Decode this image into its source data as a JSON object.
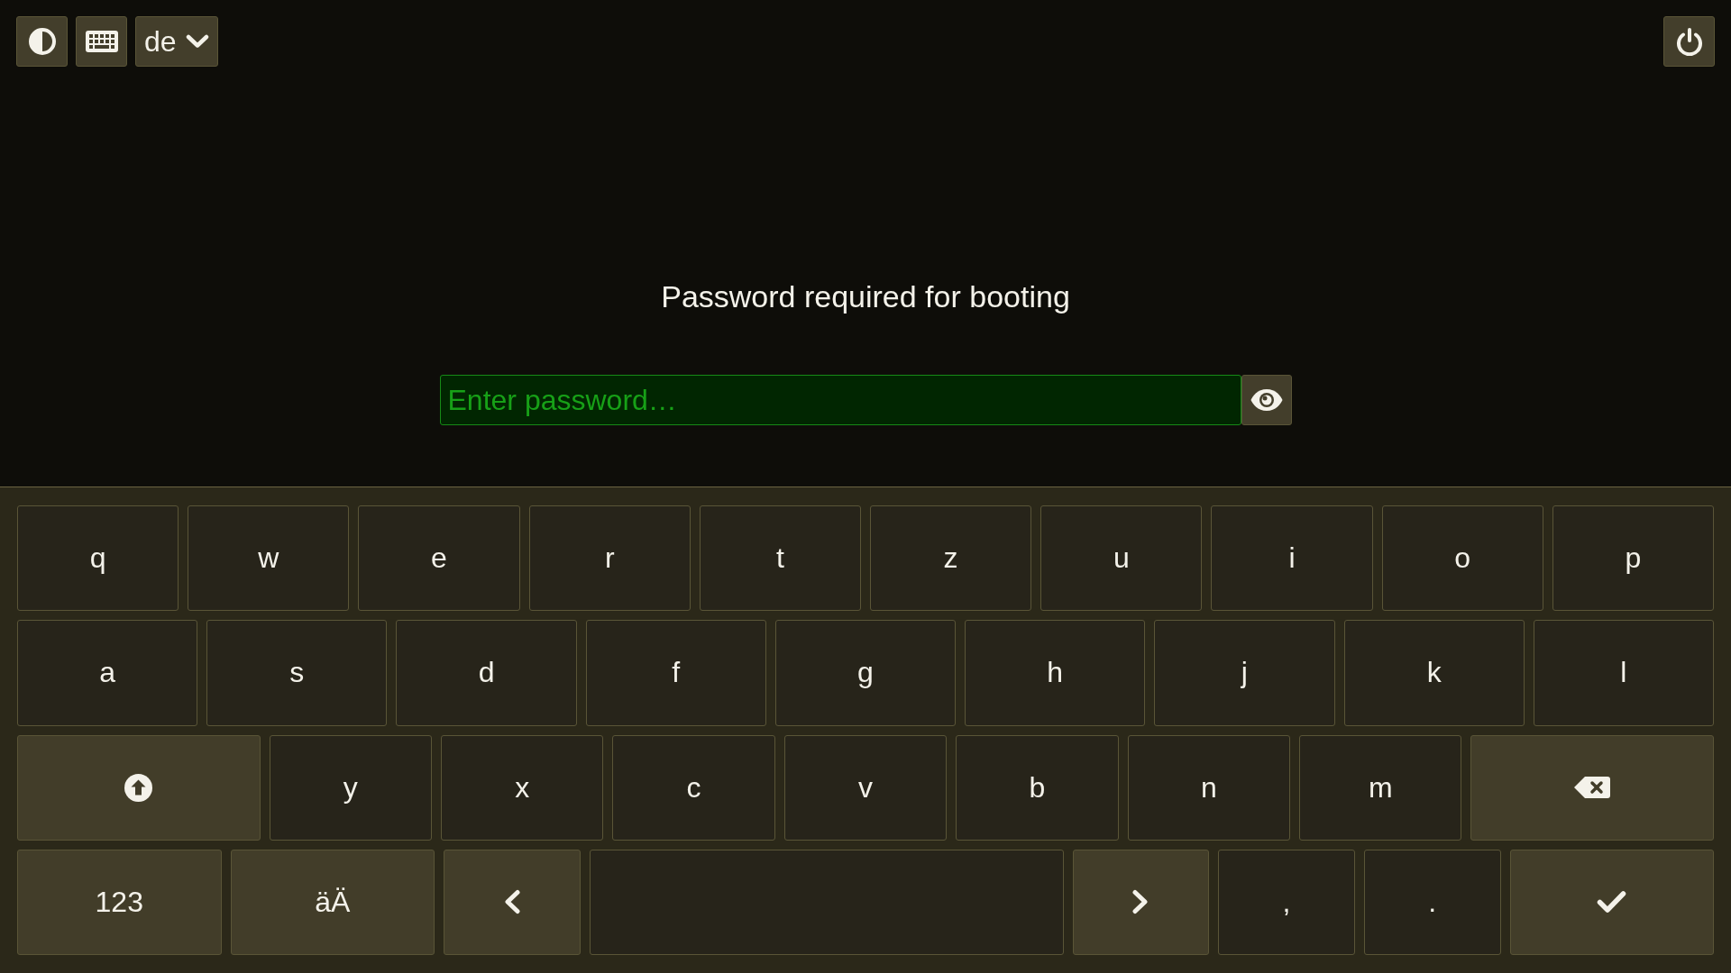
{
  "top_bar": {
    "language": "de"
  },
  "prompt": "Password required for booting",
  "password_field": {
    "placeholder": "Enter password…"
  },
  "keyboard": {
    "rows": [
      {
        "keys": [
          {
            "kind": "char",
            "label": "q"
          },
          {
            "kind": "char",
            "label": "w"
          },
          {
            "kind": "char",
            "label": "e"
          },
          {
            "kind": "char",
            "label": "r"
          },
          {
            "kind": "char",
            "label": "t"
          },
          {
            "kind": "char",
            "label": "z"
          },
          {
            "kind": "char",
            "label": "u"
          },
          {
            "kind": "char",
            "label": "i"
          },
          {
            "kind": "char",
            "label": "o"
          },
          {
            "kind": "char",
            "label": "p"
          }
        ]
      },
      {
        "keys": [
          {
            "kind": "char",
            "label": "a"
          },
          {
            "kind": "char",
            "label": "s"
          },
          {
            "kind": "char",
            "label": "d"
          },
          {
            "kind": "char",
            "label": "f"
          },
          {
            "kind": "char",
            "label": "g"
          },
          {
            "kind": "char",
            "label": "h"
          },
          {
            "kind": "char",
            "label": "j"
          },
          {
            "kind": "char",
            "label": "k"
          },
          {
            "kind": "char",
            "label": "l"
          }
        ]
      },
      {
        "keys": [
          {
            "kind": "shift"
          },
          {
            "kind": "char",
            "label": "y"
          },
          {
            "kind": "char",
            "label": "x"
          },
          {
            "kind": "char",
            "label": "c"
          },
          {
            "kind": "char",
            "label": "v"
          },
          {
            "kind": "char",
            "label": "b"
          },
          {
            "kind": "char",
            "label": "n"
          },
          {
            "kind": "char",
            "label": "m"
          },
          {
            "kind": "backspace"
          }
        ]
      },
      {
        "keys": [
          {
            "kind": "mode",
            "label": "123"
          },
          {
            "kind": "mode",
            "label": "äÄ"
          },
          {
            "kind": "left"
          },
          {
            "kind": "space"
          },
          {
            "kind": "right"
          },
          {
            "kind": "char",
            "label": ","
          },
          {
            "kind": "char",
            "label": "."
          },
          {
            "kind": "enter"
          }
        ]
      }
    ]
  }
}
